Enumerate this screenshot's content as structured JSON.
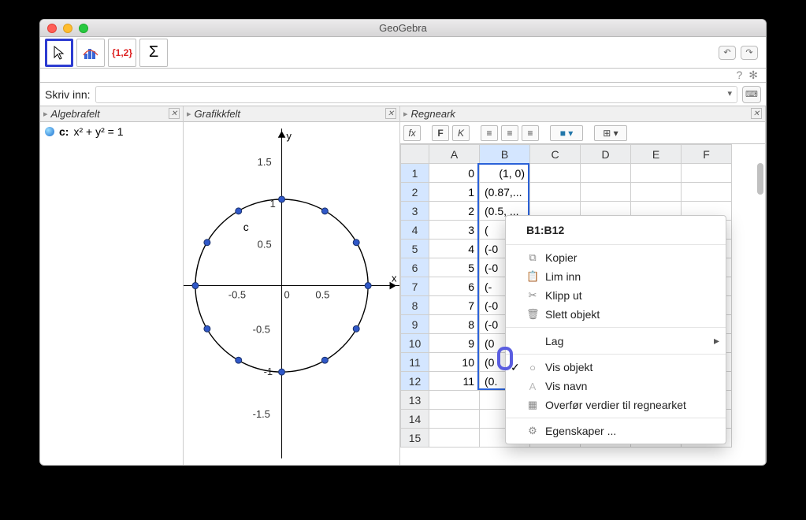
{
  "window_title": "GeoGebra",
  "toolbar": {
    "sigma_glyph": "Σ",
    "list_glyph": "{1,2}",
    "undo_glyph": "↶",
    "redo_glyph": "↷",
    "help_glyph": "?",
    "gear_glyph": "✻"
  },
  "inputbar": {
    "label": "Skriv inn:",
    "keyboard_glyph": "⌨"
  },
  "panels": {
    "algebra": "Algebrafelt",
    "graphics": "Grafikkfelt",
    "sheet": "Regneark",
    "close_glyph": "✕",
    "tri": "▸"
  },
  "algebra": {
    "equation_label": "c:",
    "equation_body": "x² + y² = 1"
  },
  "graphics": {
    "x_ticks": [
      "-0.5",
      "0",
      "0.5"
    ],
    "y_ticks": [
      "-1.5",
      "-1",
      "-0.5",
      "0.5",
      "1",
      "1.5"
    ],
    "axis_x": "x",
    "axis_y": "y",
    "circle_label": "c"
  },
  "spreadsheet": {
    "tools": {
      "fx": "fx",
      "F": "F",
      "K": "K",
      "left": "≡",
      "center": "≡",
      "right": "≡",
      "fill": "■ ▾",
      "borders": "⊞ ▾"
    },
    "columns": [
      "A",
      "B",
      "C",
      "D",
      "E",
      "F"
    ],
    "rows": [
      {
        "n": "1",
        "A": "0",
        "B": "(1, 0)"
      },
      {
        "n": "2",
        "A": "1",
        "B": "(0.87,..."
      },
      {
        "n": "3",
        "A": "2",
        "B": "(0.5, ..."
      },
      {
        "n": "4",
        "A": "3",
        "B": "("
      },
      {
        "n": "5",
        "A": "4",
        "B": "(-0"
      },
      {
        "n": "6",
        "A": "5",
        "B": "(-0"
      },
      {
        "n": "7",
        "A": "6",
        "B": "(-"
      },
      {
        "n": "8",
        "A": "7",
        "B": "(-0"
      },
      {
        "n": "9",
        "A": "8",
        "B": "(-0"
      },
      {
        "n": "10",
        "A": "9",
        "B": "(0"
      },
      {
        "n": "11",
        "A": "10",
        "B": "(0"
      },
      {
        "n": "12",
        "A": "11",
        "B": "(0."
      },
      {
        "n": "13",
        "A": "",
        "B": ""
      },
      {
        "n": "14",
        "A": "",
        "B": ""
      },
      {
        "n": "15",
        "A": "",
        "B": ""
      }
    ]
  },
  "context_menu": {
    "title": "B1:B12",
    "items": [
      {
        "label": "Kopier",
        "icon": "⧉"
      },
      {
        "label": "Lim inn",
        "icon": "📋"
      },
      {
        "label": "Klipp ut",
        "icon": "✂"
      },
      {
        "label": "Slett objekt",
        "icon": "🗑"
      }
    ],
    "submenu": {
      "label": "Lag",
      "arrow": "▸"
    },
    "toggles": [
      {
        "label": "Vis objekt",
        "checked": true,
        "icon": "○"
      },
      {
        "label": "Vis navn",
        "checked": false,
        "icon": "A"
      }
    ],
    "transfer": {
      "label": "Overfør verdier til regnearket",
      "icon": "▦"
    },
    "properties": {
      "label": "Egenskaper ...",
      "icon": "⚙"
    }
  }
}
